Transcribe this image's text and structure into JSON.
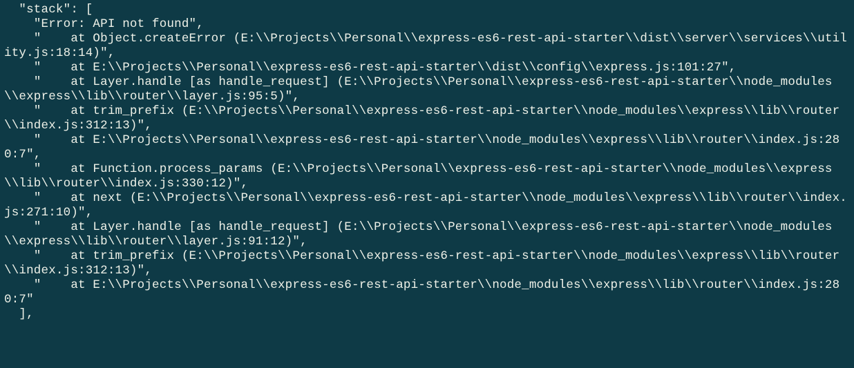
{
  "code": {
    "header": "  \"stack\": [",
    "footer": "  ],",
    "lines": [
      "\"Error: API not found\",",
      "\"    at Object.createError (E:\\\\Projects\\\\Personal\\\\express-es6-rest-api-starter\\\\dist\\\\server\\\\services\\\\utility.js:18:14)\",",
      "\"    at E:\\\\Projects\\\\Personal\\\\express-es6-rest-api-starter\\\\dist\\\\config\\\\express.js:101:27\",",
      "\"    at Layer.handle [as handle_request] (E:\\\\Projects\\\\Personal\\\\express-es6-rest-api-starter\\\\node_modules\\\\express\\\\lib\\\\router\\\\layer.js:95:5)\",",
      "\"    at trim_prefix (E:\\\\Projects\\\\Personal\\\\express-es6-rest-api-starter\\\\node_modules\\\\express\\\\lib\\\\router\\\\index.js:312:13)\",",
      "\"    at E:\\\\Projects\\\\Personal\\\\express-es6-rest-api-starter\\\\node_modules\\\\express\\\\lib\\\\router\\\\index.js:280:7\",",
      "\"    at Function.process_params (E:\\\\Projects\\\\Personal\\\\express-es6-rest-api-starter\\\\node_modules\\\\express\\\\lib\\\\router\\\\index.js:330:12)\",",
      "\"    at next (E:\\\\Projects\\\\Personal\\\\express-es6-rest-api-starter\\\\node_modules\\\\express\\\\lib\\\\router\\\\index.js:271:10)\",",
      "\"    at Layer.handle [as handle_request] (E:\\\\Projects\\\\Personal\\\\express-es6-rest-api-starter\\\\node_modules\\\\express\\\\lib\\\\router\\\\layer.js:91:12)\",",
      "\"    at trim_prefix (E:\\\\Projects\\\\Personal\\\\express-es6-rest-api-starter\\\\node_modules\\\\express\\\\lib\\\\router\\\\index.js:312:13)\",",
      "\"    at E:\\\\Projects\\\\Personal\\\\express-es6-rest-api-starter\\\\node_modules\\\\express\\\\lib\\\\router\\\\index.js:280:7\""
    ],
    "item_indent": "    "
  }
}
